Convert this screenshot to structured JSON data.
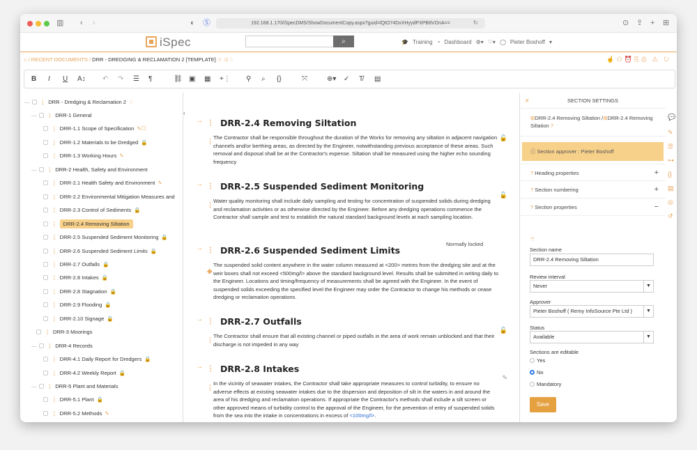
{
  "browser": {
    "url": "192.168.1.170/iSpecDMS/ShowDocumentCopy.aspx?guid=lQtO74DxXHyydPXPB8VOnA=="
  },
  "header": {
    "logo_text": "iSpec",
    "nav_training": "Training",
    "nav_dashboard": "Dashboard",
    "user_name": "Pieter Boshoff"
  },
  "breadcrumb": {
    "recent": "/ RECENT DOCUMENTS /",
    "current": "DRR - DREDGING & RECLAMATION 2 [TEMPLATE]"
  },
  "tree": {
    "root": "DRR - Dredging & Reclamation 2",
    "items": [
      {
        "label": "DRR-1 General"
      },
      {
        "label": "DRR-1.1 Scope of Specification"
      },
      {
        "label": "DRR-1.2 Materials to be Dredged"
      },
      {
        "label": "DRR-1.3 Working Hours"
      },
      {
        "label": "DRR-2 Health, Safety and Environment"
      },
      {
        "label": "DRR-2.1 Health Safety and Environment"
      },
      {
        "label": "DRR-2.2 Environmental Mitigation Measures and"
      },
      {
        "label": "DRR-2.3 Control of Sediments"
      },
      {
        "label": "DRR-2.4 Removing Siltation"
      },
      {
        "label": "DRR-2.5 Suspended Sediment Monitoring"
      },
      {
        "label": "DRR-2.6 Suspended Sediment Limits"
      },
      {
        "label": "DRR-2.7 Outfalls"
      },
      {
        "label": "DRR-2.8 Intakes"
      },
      {
        "label": "DRR-2.8 Stagnation"
      },
      {
        "label": "DRR-2.9 Flooding"
      },
      {
        "label": "DRR-2.10 Signage"
      },
      {
        "label": "DRR-3 Moorings"
      },
      {
        "label": "DRR-4 Records"
      },
      {
        "label": "DRR-4.1 Daily Report for Dredgers"
      },
      {
        "label": "DRR-4.2 Weekly Report"
      },
      {
        "label": "DRR-5 Plant and Materials"
      },
      {
        "label": "DRR-5.1 Plant"
      },
      {
        "label": "DRR-5.2 Methods"
      }
    ]
  },
  "sections": [
    {
      "title": "DRR-2.4 Removing Siltation",
      "body": "The Contractor shall be responsible throughout the duration of the Works for removing any siltation in adjacent navigation channels and/or berthing areas, as directed by the Engineer, notwithstanding previous acceptance of these areas. Such removal and disposal shall be at the Contractor's expense. Siltation shall be measured using the higher echo sounding frequency"
    },
    {
      "title": "DRR-2.5 Suspended Sediment Monitoring",
      "body": "Water quality monitoring shall include daily sampling and testing for concentration of suspended solids during dredging and reclamation activities or as otherwise directed by the Engineer. Before any dredging operations commence the Contractor shall sample and test to establish the natural standard background levels at each sampling location."
    },
    {
      "title": "DRR-2.6 Suspended Sediment Limits",
      "body": "The suspended solid content anywhere in the water column measured at <200> metres from the dredging site and at the weir boxes shall not exceed <500mg/l> above the standard background level. Results shall be submitted in writing daily to the Engineer. Locations and timing/frequency of measurements shall be agreed with the Engineer. In the event of suspended solids exceeding the specified level the Engineer may order the Contractor to change his methods or cease dredging or reclamation operations."
    },
    {
      "title": "DRR-2.7 Outfalls",
      "body": "The Contractor shall ensure that all existing channel or piped outfalls in the area of work remain unblocked and that their discharge is not impeded in any way"
    },
    {
      "title": "DRR-2.8 Intakes",
      "body": "In the vicinity of seawater intakes, the Contractor shall take appropriate measures to control turbidity, to ensure no adverse effects at existing seawater intakes due to the dispersion and deposition of silt in the waters in and around the area of his dredging and reclamation operations. If appropriate the Contractor's methods shall include a silt screen or other approved means of turbidity control to the approval of the Engineer, for the prevention of entry of suspended solids from the sea into the intake in concentrations in excess of",
      "link": "<100mg/l>",
      "tail": "."
    }
  ],
  "normally_locked": "Normally locked",
  "settings": {
    "title": "SECTION SETTINGS",
    "path1": "DRR-2.4 Removing Siltation /",
    "path2": "DRR-2.4 Removing Siltation",
    "approver_banner": "Section approver : Pieter Boshoff",
    "heading_props": "Heading properties",
    "section_numbering": "Section numbering",
    "section_props": "Section properties",
    "name_label": "Section name",
    "name_value": "DRR-2.4 Removing Siltation",
    "review_label": "Review interval",
    "review_value": "Never",
    "approver_label": "Approver",
    "approver_value": "Pieter Boshoff ( Remy InfoSource Pte Ltd )",
    "status_label": "Status",
    "status_value": "Available",
    "editable_label": "Sections are editable",
    "opt_yes": "Yes",
    "opt_no": "No",
    "opt_mandatory": "Mandatory",
    "save": "Save"
  }
}
